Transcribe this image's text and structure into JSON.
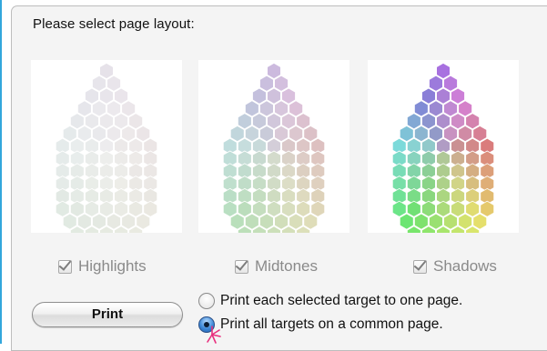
{
  "dialog": {
    "prompt": "Please select page layout:"
  },
  "targets": [
    {
      "label": "Highlights",
      "checked": true,
      "icon": "highlights-hex-swatch"
    },
    {
      "label": "Midtones",
      "checked": true,
      "icon": "midtones-hex-swatch"
    },
    {
      "label": "Shadows",
      "checked": true,
      "icon": "shadows-hex-swatch"
    }
  ],
  "print_button": {
    "label": "Print"
  },
  "layout_options": [
    {
      "label": "Print each selected target to one page.",
      "selected": false
    },
    {
      "label": "Print all targets on a common page.",
      "selected": true
    }
  ],
  "colors": {
    "accent_edge": "#33a7dc",
    "radio_selected": "#3f8ad8"
  }
}
